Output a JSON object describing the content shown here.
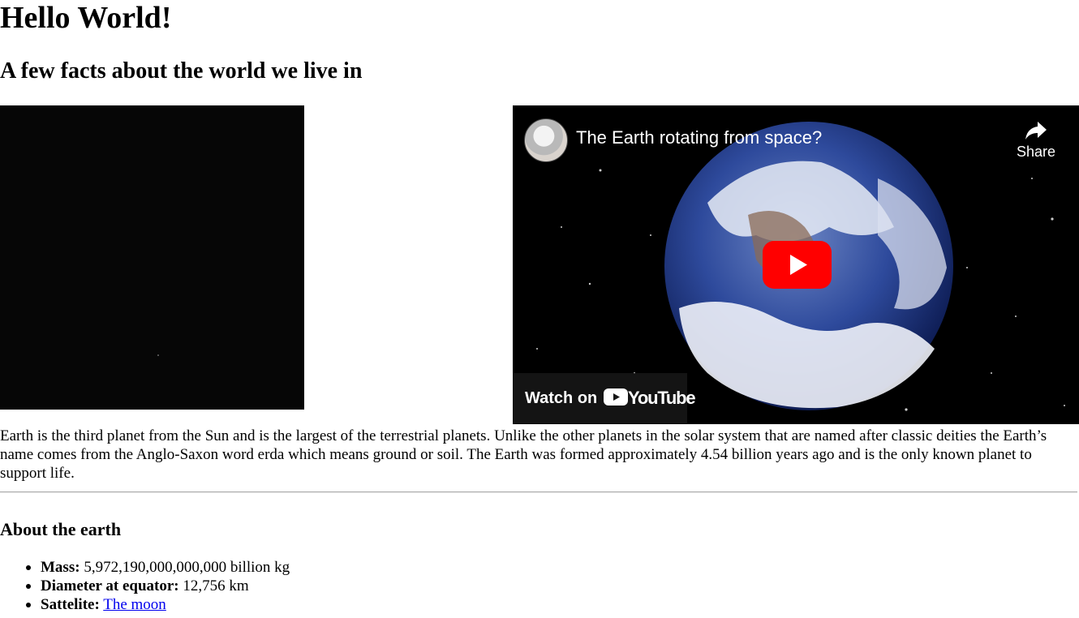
{
  "page": {
    "title": "Hello World!",
    "subtitle": "A few facts about the world we live in"
  },
  "video": {
    "title": "The Earth rotating from space?",
    "share_label": "Share",
    "watch_on_label": "Watch on",
    "platform_label": "YouTube"
  },
  "intro_text": "Earth is the third planet from the Sun and is the largest of the terrestrial planets. Unlike the other planets in the solar system that are named after classic deities the Earth’s name comes from the Anglo-Saxon word erda which means ground or soil. The Earth was formed approximately 4.54 billion years ago and is the only known planet to support life.",
  "about": {
    "heading": "About the earth",
    "facts": [
      {
        "label": "Mass:",
        "value": " 5,972,190,000,000,000 billion kg"
      },
      {
        "label": "Diameter at equator:",
        "value": " 12,756 km"
      },
      {
        "label": "Sattelite:",
        "value": "The moon"
      }
    ]
  },
  "colors": {
    "link": "#0000ee",
    "youtube_red": "#ff0000",
    "divider": "#a8a8a8"
  },
  "icons": [
    "share-icon",
    "play-icon",
    "youtube-logo-icon"
  ]
}
